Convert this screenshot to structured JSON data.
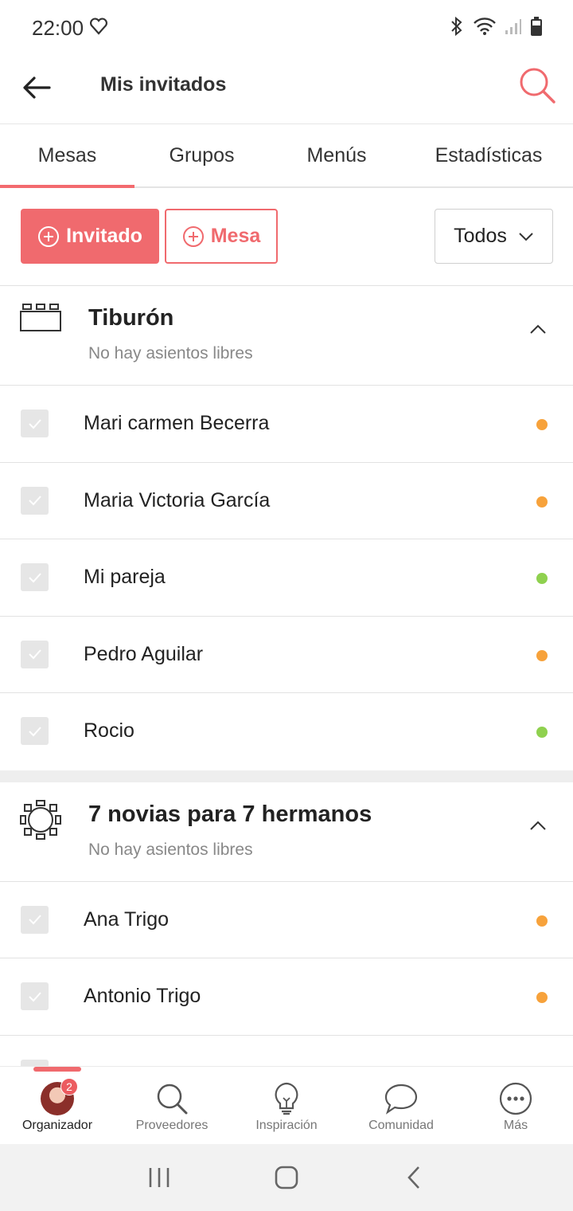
{
  "status_bar": {
    "time": "22:00"
  },
  "app_bar": {
    "title": "Mis invitados"
  },
  "tabs": [
    {
      "label": "Mesas",
      "active": true
    },
    {
      "label": "Grupos",
      "active": false
    },
    {
      "label": "Menús",
      "active": false
    },
    {
      "label": "Estadísticas",
      "active": false
    }
  ],
  "actions": {
    "add_guest_label": "Invitado",
    "add_table_label": "Mesa",
    "filter_value": "Todos"
  },
  "groups": [
    {
      "title": "Tiburón",
      "subtitle": "No hay asientos libres",
      "icon": "rectangular-table-icon",
      "guests": [
        {
          "name": "Mari carmen Becerra",
          "status_color": "#f7a23b"
        },
        {
          "name": "Maria Victoria García",
          "status_color": "#f7a23b"
        },
        {
          "name": "Mi pareja",
          "status_color": "#8fd14f"
        },
        {
          "name": "Pedro Aguilar",
          "status_color": "#f7a23b"
        },
        {
          "name": "Rocio",
          "status_color": "#8fd14f"
        }
      ]
    },
    {
      "title": "7 novias para 7 hermanos",
      "subtitle": "No hay asientos libres",
      "icon": "round-table-icon",
      "guests": [
        {
          "name": "Ana Trigo",
          "status_color": "#f7a23b"
        },
        {
          "name": "Antonio Trigo",
          "status_color": "#f7a23b"
        }
      ]
    }
  ],
  "bottom_nav": {
    "items": [
      {
        "label": "Organizador",
        "icon": "avatar",
        "active": true,
        "badge": "2"
      },
      {
        "label": "Proveedores",
        "icon": "search-icon"
      },
      {
        "label": "Inspiración",
        "icon": "lightbulb-icon"
      },
      {
        "label": "Comunidad",
        "icon": "chat-bubble-icon"
      },
      {
        "label": "Más",
        "icon": "more-icon"
      }
    ]
  },
  "colors": {
    "accent": "#f06a6e",
    "pending": "#f7a23b",
    "confirmed": "#8fd14f"
  }
}
